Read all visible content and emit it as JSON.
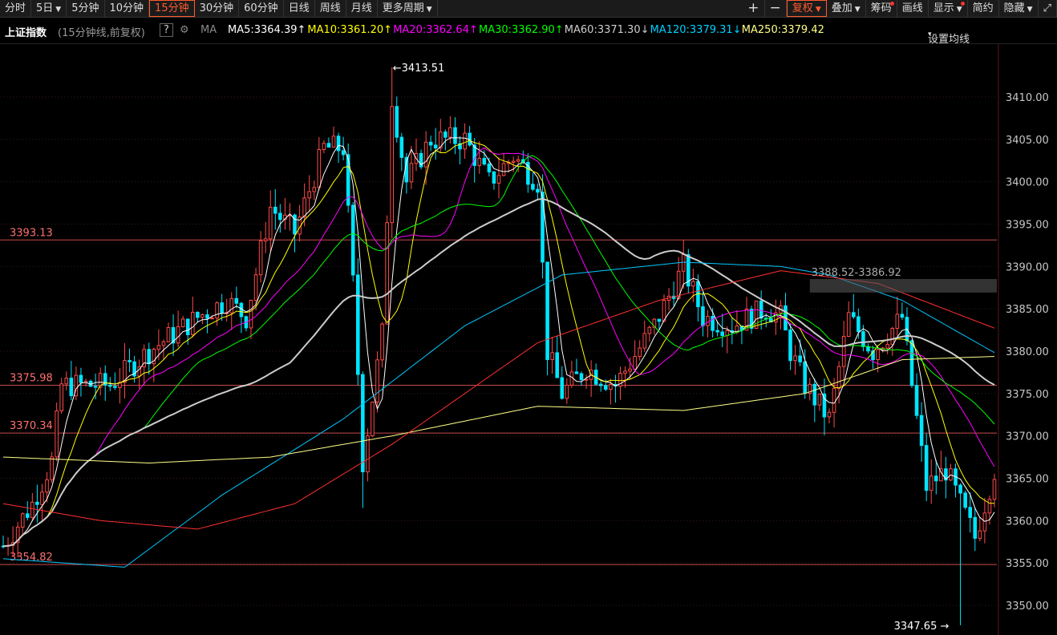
{
  "toolbar": {
    "left_items": [
      {
        "label": "分时",
        "dropdown": false
      },
      {
        "label": "5日",
        "dropdown": true
      },
      {
        "label": "5分钟",
        "dropdown": false
      },
      {
        "label": "10分钟",
        "dropdown": false
      },
      {
        "label": "15分钟",
        "dropdown": false,
        "active": true
      },
      {
        "label": "30分钟",
        "dropdown": false
      },
      {
        "label": "60分钟",
        "dropdown": false
      },
      {
        "label": "日线",
        "dropdown": false
      },
      {
        "label": "周线",
        "dropdown": false
      },
      {
        "label": "月线",
        "dropdown": false
      },
      {
        "label": "更多周期",
        "dropdown": true
      }
    ],
    "zoom_in": "+",
    "zoom_out": "−",
    "right_items": [
      {
        "label": "复权",
        "dropdown": true,
        "active": true
      },
      {
        "label": "叠加",
        "dropdown": true
      },
      {
        "label": "筹码",
        "dot": true
      },
      {
        "label": "画线"
      },
      {
        "label": "显示",
        "dropdown": true,
        "dot": true
      },
      {
        "label": "简约"
      },
      {
        "label": "隐藏",
        "dropdown": true
      }
    ],
    "expand_icon": "⤢"
  },
  "info": {
    "name": "上证指数",
    "period": "(15分钟线,前复权)",
    "help": "?",
    "ma_label": "MA",
    "ma": [
      {
        "text": "MA5:3364.39",
        "arrow": "↑",
        "color": "#ffffff"
      },
      {
        "text": "MA10:3361.20",
        "arrow": "↑",
        "color": "#ffff00"
      },
      {
        "text": "MA20:3362.64",
        "arrow": "↑",
        "color": "#ff00ff"
      },
      {
        "text": "MA30:3362.90",
        "arrow": "↑",
        "color": "#00ff00"
      },
      {
        "text": "MA60:3371.30",
        "arrow": "↓",
        "color": "#cccccc"
      },
      {
        "text": "MA120:3379.31",
        "arrow": "↓",
        "color": "#00d0ff"
      },
      {
        "text": "MA250:3379.42",
        "arrow": "",
        "color": "#ffff88"
      }
    ],
    "settings": "设置均线"
  },
  "colors": {
    "up": "#ff4a4a",
    "down": "#00e5ff",
    "hline": "#c84a4a",
    "axis_text": "#c8c8c8",
    "grid": "#3a1a1a"
  },
  "chart_data": {
    "type": "candlestick",
    "title": "上证指数",
    "ylim": [
      3347.0,
      3417.0
    ],
    "yticks": [
      "3350.00",
      "3355.00",
      "3360.00",
      "3365.00",
      "3370.00",
      "3375.00",
      "3380.00",
      "3385.00",
      "3390.00",
      "3395.00",
      "3400.00",
      "3405.00",
      "3410.00"
    ],
    "horizontal_lines": [
      {
        "value": 3393.13,
        "label": "3393.13"
      },
      {
        "value": 3375.98,
        "label": "3375.98"
      },
      {
        "value": 3370.34,
        "label": "3370.34"
      },
      {
        "value": 3354.82,
        "label": "3354.82"
      }
    ],
    "annotations": {
      "high": {
        "value": 3413.51,
        "label": "←3413.51",
        "index": 80
      },
      "low": {
        "value": 3347.65,
        "label": "3347.65 →",
        "index": 197
      },
      "zone": {
        "from": 3388.52,
        "to": 3386.92,
        "label": "3388.52-3386.92",
        "start_index": 166
      }
    },
    "candles": 205,
    "key_prices": [
      [
        0,
        3357
      ],
      [
        6,
        3362
      ],
      [
        10,
        3367
      ],
      [
        12,
        3376
      ],
      [
        22,
        3376
      ],
      [
        30,
        3380
      ],
      [
        40,
        3384
      ],
      [
        46,
        3386
      ],
      [
        50,
        3384
      ],
      [
        55,
        3397
      ],
      [
        60,
        3394
      ],
      [
        66,
        3404
      ],
      [
        70,
        3404
      ],
      [
        72,
        3388
      ],
      [
        74,
        3367
      ],
      [
        78,
        3382
      ],
      [
        80,
        3410
      ],
      [
        83,
        3400
      ],
      [
        88,
        3405
      ],
      [
        95,
        3405
      ],
      [
        100,
        3400
      ],
      [
        105,
        3403
      ],
      [
        110,
        3400
      ],
      [
        112,
        3380
      ],
      [
        115,
        3375
      ],
      [
        120,
        3378
      ],
      [
        126,
        3376
      ],
      [
        134,
        3383
      ],
      [
        140,
        3390
      ],
      [
        144,
        3384
      ],
      [
        150,
        3383
      ],
      [
        157,
        3385
      ],
      [
        160,
        3384
      ],
      [
        162,
        3380
      ],
      [
        165,
        3376
      ],
      [
        170,
        3372
      ],
      [
        174,
        3384
      ],
      [
        179,
        3380
      ],
      [
        185,
        3384
      ],
      [
        190,
        3364
      ],
      [
        194,
        3366
      ],
      [
        200,
        3358
      ],
      [
        204,
        3366
      ]
    ],
    "ma_lines": [
      {
        "name": "MA5",
        "color": "#ffffff",
        "period": 5
      },
      {
        "name": "MA10",
        "color": "#ffff00",
        "period": 10
      },
      {
        "name": "MA20",
        "color": "#ff00ff",
        "period": 20
      },
      {
        "name": "MA30",
        "color": "#00ff00",
        "period": 30
      },
      {
        "name": "MA60",
        "color": "#cccccc",
        "period": 60
      },
      {
        "name": "MA120",
        "color": "#00c8ff",
        "path": [
          [
            0,
            3355.5
          ],
          [
            25,
            3354.5
          ],
          [
            45,
            3363
          ],
          [
            70,
            3372
          ],
          [
            95,
            3383
          ],
          [
            115,
            3389
          ],
          [
            140,
            3390.5
          ],
          [
            160,
            3390
          ],
          [
            170,
            3389
          ],
          [
            185,
            3386
          ],
          [
            205,
            3379.5
          ]
        ]
      },
      {
        "name": "MA250",
        "color": "#ffff88",
        "path": [
          [
            0,
            3367.5
          ],
          [
            30,
            3366.8
          ],
          [
            55,
            3367.5
          ],
          [
            80,
            3370
          ],
          [
            110,
            3373.5
          ],
          [
            140,
            3373
          ],
          [
            165,
            3375
          ],
          [
            185,
            3379
          ],
          [
            205,
            3379.4
          ]
        ]
      },
      {
        "name": "MA_red",
        "color": "#ff3030",
        "path": [
          [
            0,
            3362
          ],
          [
            20,
            3360
          ],
          [
            40,
            3359
          ],
          [
            60,
            3362
          ],
          [
            80,
            3369
          ],
          [
            110,
            3381
          ],
          [
            135,
            3386
          ],
          [
            160,
            3389.5
          ],
          [
            180,
            3388
          ],
          [
            205,
            3382.5
          ]
        ]
      }
    ]
  }
}
